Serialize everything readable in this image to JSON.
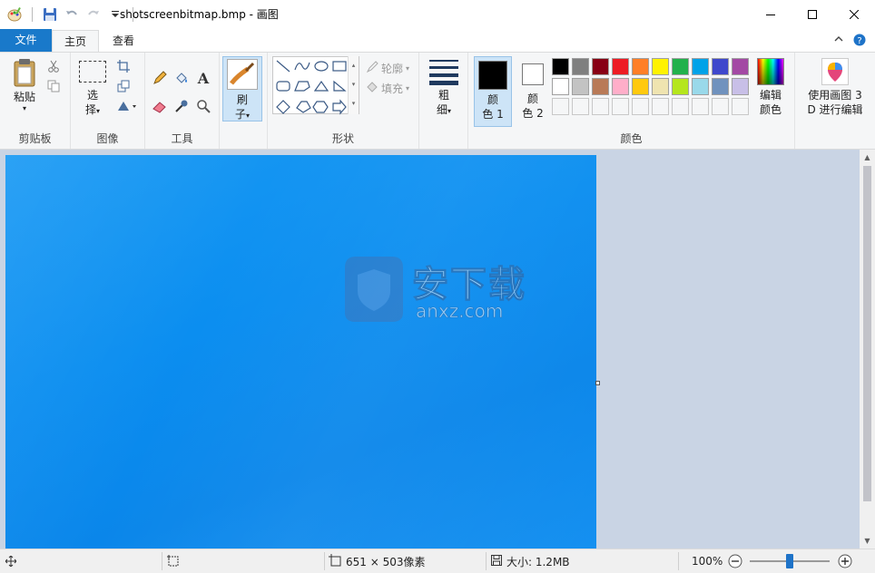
{
  "window": {
    "title": "shotscreenbitmap.bmp - 画图",
    "minimize_icon": "minimize-icon",
    "maximize_icon": "maximize-icon",
    "close_icon": "close-icon"
  },
  "tabs": {
    "file": "文件",
    "home": "主页",
    "view": "查看"
  },
  "ribbon": {
    "clipboard": {
      "label": "剪贴板",
      "paste": "粘贴"
    },
    "image": {
      "label": "图像",
      "select_line1": "选",
      "select_line2": "择"
    },
    "tools": {
      "label": "工具"
    },
    "brushes": {
      "line1": "刷",
      "line2": "子"
    },
    "shapes": {
      "label": "形状",
      "outline": "轮廓",
      "fill": "填充"
    },
    "size": {
      "line1": "粗",
      "line2": "细"
    },
    "colors": {
      "label": "颜色",
      "color1_line1": "颜",
      "color1_line2": "色 1",
      "color2_line1": "颜",
      "color2_line2": "色 2",
      "edit_line1": "编辑",
      "edit_line2": "颜色",
      "color1": "#000000",
      "color2": "#ffffff",
      "palette_row1": [
        "#000000",
        "#7f7f7f",
        "#880015",
        "#ed1c24",
        "#ff7f27",
        "#fff200",
        "#22b14c",
        "#00a2e8",
        "#3f48cc",
        "#a349a4"
      ],
      "palette_row2": [
        "#ffffff",
        "#c3c3c3",
        "#b97a57",
        "#ffaec9",
        "#ffc90e",
        "#efe4b0",
        "#b5e61d",
        "#99d9ea",
        "#7092be",
        "#c8bfe7"
      ]
    },
    "paint3d": {
      "line1": "使用画图 3",
      "line2": "D 进行编辑"
    }
  },
  "watermark": {
    "main": "安下载",
    "sub": "anxz.com"
  },
  "status": {
    "dimensions": "651 × 503像素",
    "size": "大小: 1.2MB",
    "zoom": "100%"
  }
}
